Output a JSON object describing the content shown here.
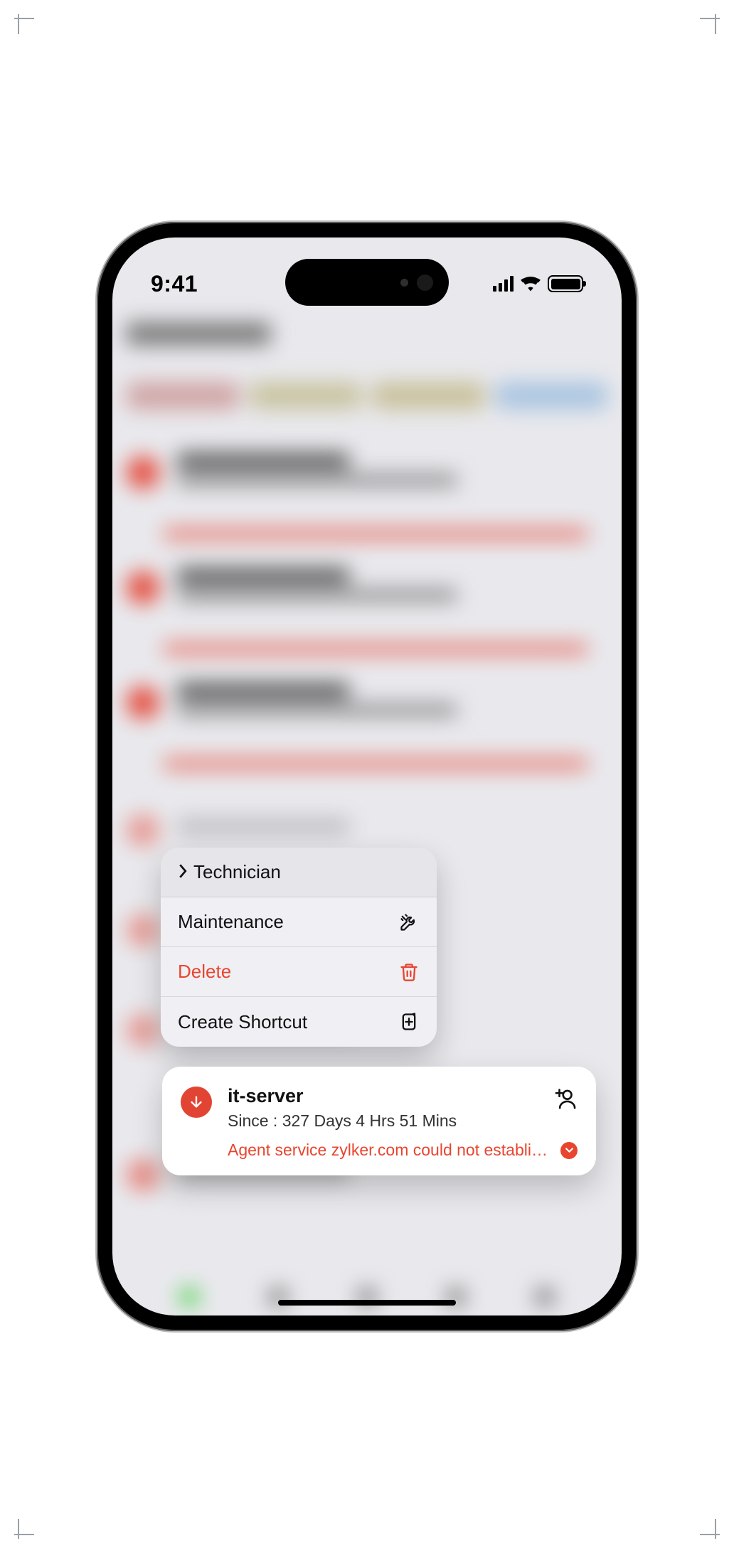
{
  "status": {
    "time": "9:41"
  },
  "context_menu": {
    "items": [
      {
        "label": "Technician"
      },
      {
        "label": "Maintenance"
      },
      {
        "label": "Delete"
      },
      {
        "label": "Create Shortcut"
      }
    ]
  },
  "card": {
    "title": "it-server",
    "since_label": "Since : 327 Days 4 Hrs 51 Mins",
    "message": "Agent service zylker.com could not establish..."
  },
  "colors": {
    "danger": "#e8452f",
    "accent_red": "#e24434"
  }
}
